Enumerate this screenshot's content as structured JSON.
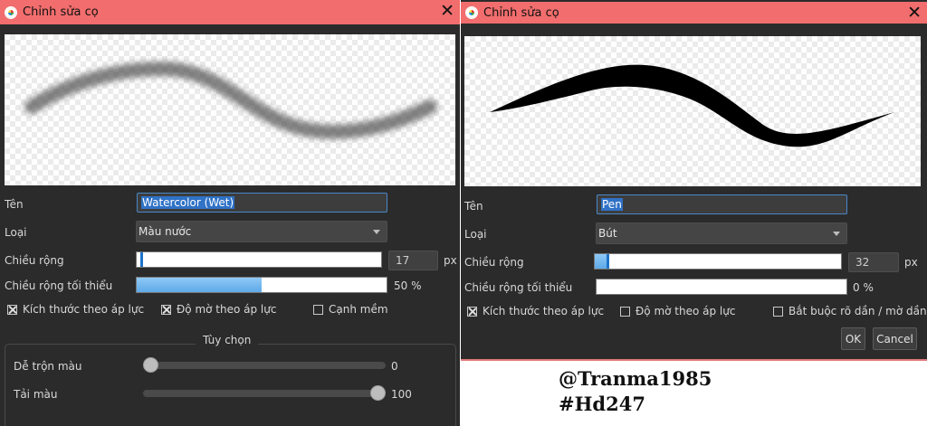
{
  "left_dialog": {
    "title": "Chỉnh sửa cọ",
    "close_glyph": "✕",
    "name_label": "Tên",
    "name_value": "Watercolor (Wet)",
    "type_label": "Loại",
    "type_value": "Màu nước",
    "width_label": "Chiều rộng",
    "width_value": "17",
    "width_unit": "px",
    "width_fraction": 0.02,
    "min_width_label": "Chiều rộng tối thiểu",
    "min_width_value": "50 %",
    "min_width_fraction": 0.5,
    "checkboxes": [
      {
        "label": "Kích thước theo áp lực",
        "checked": true
      },
      {
        "label": "Độ mờ theo áp lực",
        "checked": true
      },
      {
        "label": "Cạnh mềm",
        "checked": false
      }
    ],
    "options_title": "Tùy chọn",
    "blend_label": "Dễ trộn màu",
    "blend_value": "0",
    "blend_fraction": 0,
    "load_label": "Tải màu",
    "load_value": "100",
    "load_fraction": 1
  },
  "right_dialog": {
    "title": "Chỉnh sửa cọ",
    "close_glyph": "✕",
    "name_label": "Tên",
    "name_value": "Pen",
    "type_label": "Loại",
    "type_value": "Bút",
    "width_label": "Chiều rộng",
    "width_value": "32",
    "width_unit": "px",
    "width_fraction": 0.05,
    "min_width_label": "Chiều rộng tối thiểu",
    "min_width_value": "0 %",
    "min_width_fraction": 0,
    "checkboxes": [
      {
        "label": "Kích thước theo áp lực",
        "checked": true
      },
      {
        "label": "Độ mờ theo áp lực",
        "checked": false
      },
      {
        "label": "Bắt buộc rõ dần / mờ dần",
        "checked": false
      }
    ],
    "ok_label": "OK",
    "cancel_label": "Cancel"
  },
  "watermark": {
    "line1": "@Tranma1985",
    "line2": "#Hd247"
  },
  "colors": {
    "titlebar": "#f26d6d",
    "dialog_bg": "#2b2b2b",
    "slider_fill": "#5ea9e8",
    "selection": "#2f72c6"
  },
  "icons": [
    "app-icon",
    "close-icon",
    "dropdown-arrow-icon",
    "checkbox-icon"
  ]
}
